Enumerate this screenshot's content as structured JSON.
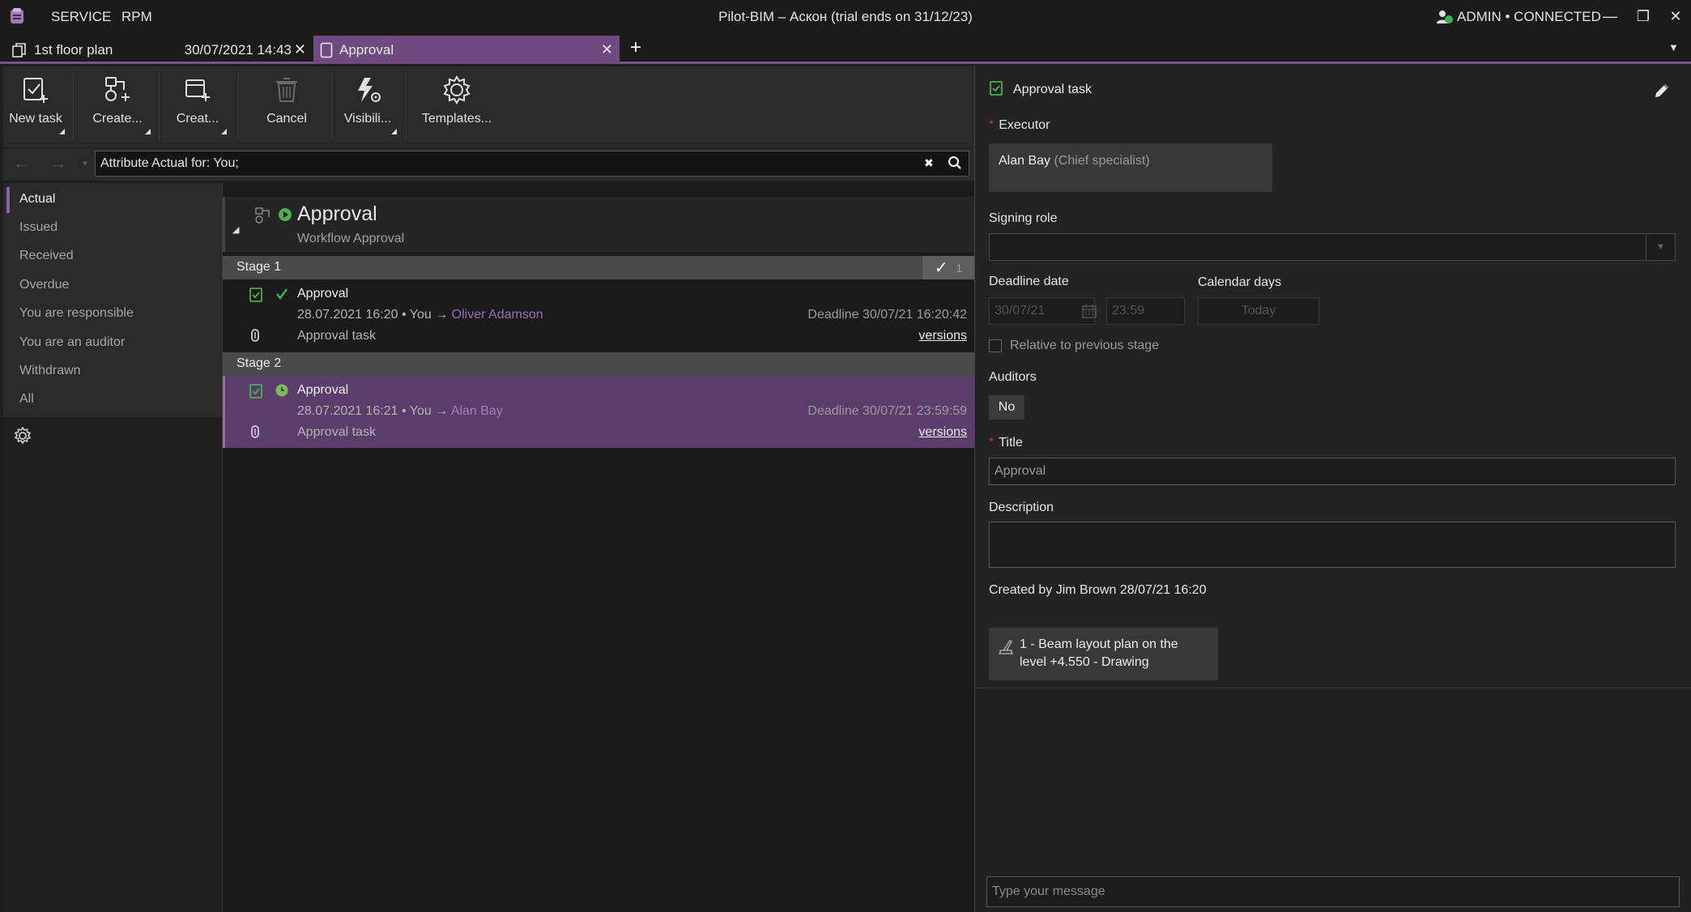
{
  "app": {
    "title": "Pilot-BIM – Аскон (trial ends on 31/12/23)",
    "menu": [
      "SERVICE",
      "RPM"
    ],
    "connection": "ADMIN • CONNECTED",
    "window_controls": {
      "minimize": "—",
      "restore": "❐",
      "close": "✕"
    },
    "accent_color": "#7b4f8b"
  },
  "tabs": [
    {
      "label": "1st floor plan",
      "date": "30/07/2021 14:43",
      "icon": "document-icon"
    },
    {
      "label": "Approval",
      "icon": "task-icon",
      "active": true
    }
  ],
  "toolbar": {
    "buttons": [
      {
        "label": "New task",
        "icon": "new-task-icon",
        "dropdown": true
      },
      {
        "label": "Create...",
        "icon": "create-workflow-icon",
        "dropdown": true
      },
      {
        "label": "Creat...",
        "icon": "create-stage-icon",
        "dropdown": true
      },
      {
        "label": "Cancel",
        "icon": "trash-icon",
        "dropdown": false,
        "disabled": true
      },
      {
        "label": "Visibili...",
        "icon": "visibility-icon",
        "dropdown": true
      },
      {
        "label": "Templates...",
        "icon": "templates-icon",
        "dropdown": false
      }
    ]
  },
  "filter": {
    "value": "Attribute  Actual for: You;"
  },
  "sidebar": {
    "items": [
      {
        "label": "Actual",
        "active": true
      },
      {
        "label": "Issued"
      },
      {
        "label": "Received"
      },
      {
        "label": "Overdue"
      },
      {
        "label": "You are responsible"
      },
      {
        "label": "You are an auditor"
      },
      {
        "label": "Withdrawn"
      },
      {
        "label": "All"
      }
    ]
  },
  "workflow": {
    "title": "Approval",
    "subtitle": "Workflow Approval",
    "stages": [
      {
        "label": "Stage 1",
        "count": "1",
        "task": {
          "name": "Approval",
          "meta_prefix": "28.07.2021 16:20 • You →",
          "assignee": "Oliver Adamson",
          "type": "Approval task",
          "deadline": "Deadline 30/07/21 16:20:42",
          "versions": "versions",
          "status": "completed"
        }
      },
      {
        "label": "Stage 2",
        "task": {
          "name": "Approval",
          "meta_prefix": "28.07.2021 16:21 • You →",
          "assignee": "Alan Bay",
          "type": "Approval task",
          "deadline": "Deadline 30/07/21 23:59:59",
          "versions": "versions",
          "status": "in-progress"
        }
      }
    ]
  },
  "details": {
    "header": "Approval task",
    "executor_label": "Executor",
    "executor_name": "Alan Bay",
    "executor_role": "(Chief specialist)",
    "signing_role_label": "Signing role",
    "deadline_label": "Deadline date",
    "deadline_date": "30/07/21",
    "deadline_time": "23:59",
    "calendar_days_label": "Calendar days",
    "calendar_days_value": "Today",
    "relative_label": "Relative to previous stage",
    "auditors_label": "Auditors",
    "auditors_value": "No",
    "title_label": "Title",
    "title_value": "Approval",
    "description_label": "Description",
    "created_by": "Created by Jim Brown 28/07/21 16:20",
    "document_line1": "1 - Beam layout plan on the",
    "document_line2": "level +4.550 - Drawing",
    "message_placeholder": "Type your message"
  }
}
